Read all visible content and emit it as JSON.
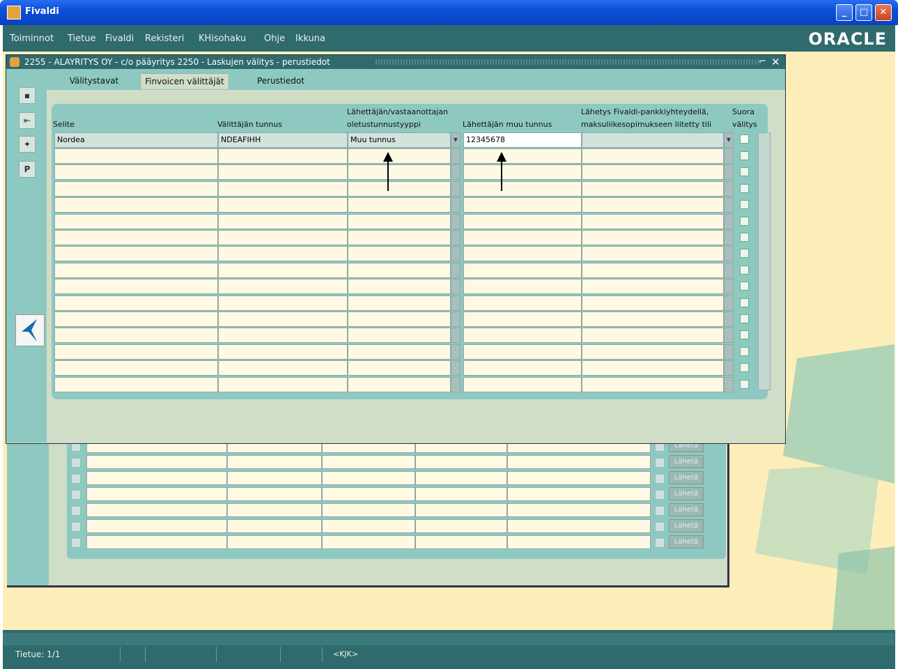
{
  "app": {
    "title": "Fivaldi",
    "brand": "ORACLE"
  },
  "menu": [
    "Toiminnot",
    "Tietue",
    "Fivaldi",
    "Rekisteri",
    "KHisohaku",
    "Ohje",
    "Ikkuna"
  ],
  "window": {
    "title": "2255 - ALAYRITYS OY - c/o pääyritys 2250 - Laskujen välitys - perustiedot",
    "tabs": [
      "Välitystavat",
      "Finvoicen välittäjät",
      "Perustiedot"
    ],
    "active_tab": "Finvoicen välittäjät"
  },
  "grid": {
    "headers": {
      "selite": "Selite",
      "valittajan_tunnus": "Välittäjän tunnus",
      "tunnustyyppi_line1": "Lähettäjän/vastaanottajan",
      "tunnustyyppi_line2": "oletustunnustyyppi",
      "muu_tunnus": "Lähettäjän muu tunnus",
      "lahetys_line1": "Lähetys Fivaldi-pankkiyhteydellä,",
      "lahetys_line2": "maksuliikesopimukseen liitetty tili",
      "suora_line1": "Suora",
      "suora_line2": "välitys"
    },
    "rows": [
      {
        "selite": "Nordea",
        "valittajan_tunnus": "NDEAFIHH",
        "tunnustyyppi": "Muu tunnus",
        "muu_tunnus": "12345678",
        "lahetys": "",
        "suora": false
      }
    ],
    "empty_rows": 15
  },
  "back_form": {
    "button_label": "Lähetä",
    "rows": 7
  },
  "status": {
    "record": "Tietue: 1/1",
    "mode": "<KJK>"
  },
  "colors": {
    "title_blue": "#0a4fd8",
    "teal": "#2f6a6c",
    "panel_teal": "#8ec9c1",
    "field_bg": "#fff9e3",
    "form_bg": "#d0ddc7",
    "background": "#fdeeb9"
  }
}
